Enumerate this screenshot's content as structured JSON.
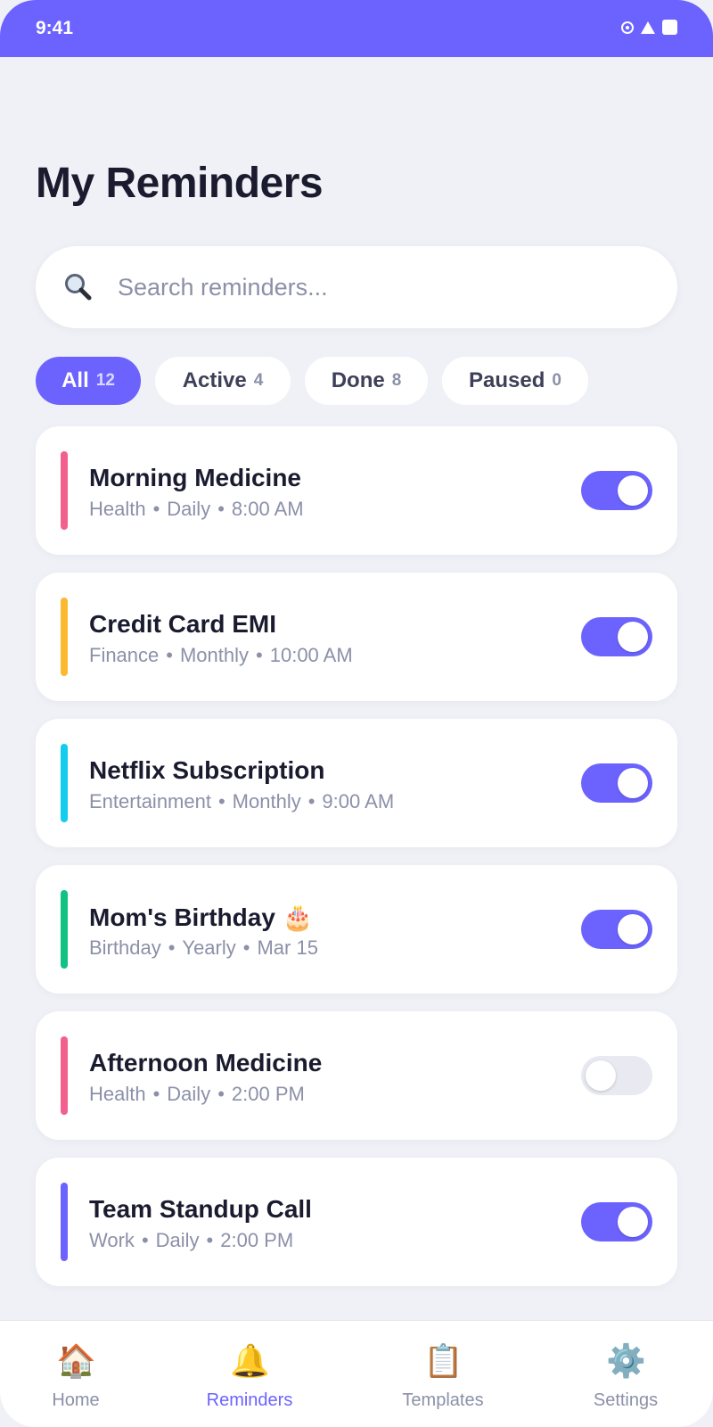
{
  "status_bar": {
    "time": "9:41"
  },
  "page_title": "My Reminders",
  "search": {
    "placeholder": "Search reminders...",
    "value": ""
  },
  "filters": [
    {
      "label": "All",
      "count": "12",
      "selected": true
    },
    {
      "label": "Active",
      "count": "4",
      "selected": false
    },
    {
      "label": "Done",
      "count": "8",
      "selected": false
    },
    {
      "label": "Paused",
      "count": "0",
      "selected": false
    }
  ],
  "reminders": [
    {
      "title": "Morning Medicine",
      "category": "Health",
      "frequency": "Daily",
      "when": "8:00 AM",
      "accent": "#f2608e",
      "enabled": true
    },
    {
      "title": "Credit Card EMI",
      "category": "Finance",
      "frequency": "Monthly",
      "when": "10:00 AM",
      "accent": "#fbb92f",
      "enabled": true
    },
    {
      "title": "Netflix Subscription",
      "category": "Entertainment",
      "frequency": "Monthly",
      "when": "9:00 AM",
      "accent": "#13cdee",
      "enabled": true
    },
    {
      "title": "Mom's Birthday 🎂",
      "category": "Birthday",
      "frequency": "Yearly",
      "when": "Mar 15",
      "accent": "#12c283",
      "enabled": true
    },
    {
      "title": "Afternoon Medicine",
      "category": "Health",
      "frequency": "Daily",
      "when": "2:00 PM",
      "accent": "#f2608e",
      "enabled": false
    },
    {
      "title": "Team Standup Call",
      "category": "Work",
      "frequency": "Daily",
      "when": "2:00 PM",
      "accent": "#6c63ff",
      "enabled": true
    }
  ],
  "bottom_nav": [
    {
      "label": "Home",
      "icon": "🏠",
      "selected": false
    },
    {
      "label": "Reminders",
      "icon": "🔔",
      "selected": true
    },
    {
      "label": "Templates",
      "icon": "📋",
      "selected": false
    },
    {
      "label": "Settings",
      "icon": "⚙️",
      "selected": false
    }
  ],
  "colors": {
    "brand": "#6c63ff",
    "background": "#f0f1f6",
    "muted_text": "#8c90a8"
  }
}
